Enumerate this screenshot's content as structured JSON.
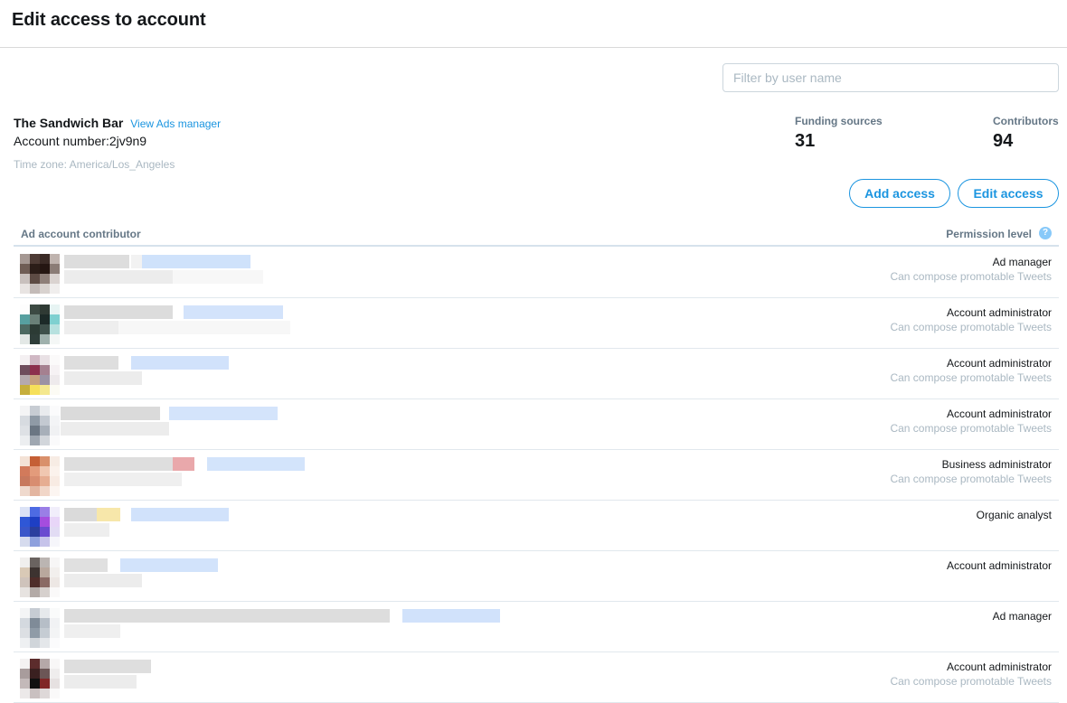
{
  "page": {
    "title": "Edit access to account"
  },
  "filter": {
    "placeholder": "Filter by user name",
    "value": ""
  },
  "account": {
    "name": "The Sandwich Bar",
    "view_ads_manager_label": "View Ads manager",
    "number_text": "Account number:2jv9n9",
    "timezone_text": "Time zone: America/Los_Angeles"
  },
  "stats": {
    "funding_sources_label": "Funding sources",
    "funding_sources_value": "31",
    "contributors_label": "Contributors",
    "contributors_value": "94"
  },
  "actions": {
    "add_access_label": "Add access",
    "edit_access_label": "Edit access"
  },
  "table": {
    "col_contributor": "Ad account contributor",
    "col_permission": "Permission level",
    "help_glyph": "?",
    "rows": [
      {
        "permission": "Ad manager",
        "sub": "Can compose promotable Tweets",
        "avatar": [
          "#a59893",
          "#4d3b35",
          "#3b2b26",
          "#bfb3ae",
          "#6f5d55",
          "#2b1d18",
          "#251612",
          "#8b7c76",
          "#c8c0bd",
          "#5d4b44",
          "#8e7f79",
          "#dad3d0",
          "#e8e4e2",
          "#c3bbb8",
          "#d8d2cf",
          "#f0eeed"
        ]
      },
      {
        "permission": "Account administrator",
        "sub": "Can compose promotable Tweets",
        "avatar": [
          "#fdfdfd",
          "#3c4a43",
          "#2f3a34",
          "#e7f4f3",
          "#57a0a0",
          "#6a8078",
          "#1c2a28",
          "#7ed0d0",
          "#4d6a62",
          "#2c3b35",
          "#3e504b",
          "#b7e1df",
          "#e3e8e6",
          "#2f3e3a",
          "#9fb1ad",
          "#f4f7f6"
        ]
      },
      {
        "permission": "Account administrator",
        "sub": "Can compose promotable Tweets",
        "avatar": [
          "#f4f0f2",
          "#d0b8c4",
          "#e9e1e5",
          "#fbfafa",
          "#6e4c5c",
          "#8c2f4d",
          "#a58090",
          "#f6f2f4",
          "#b5a9ae",
          "#c5a07f",
          "#9b92a4",
          "#eeeaec",
          "#c6ae3c",
          "#f6e05a",
          "#f4e88e",
          "#fcfbf4"
        ]
      },
      {
        "permission": "Account administrator",
        "sub": "Can compose promotable Tweets",
        "avatar": [
          "#f4f4f5",
          "#c7ccd3",
          "#e9ebee",
          "#fbfbfc",
          "#d7dbe0",
          "#8f9aa6",
          "#c3c9d1",
          "#f3f4f6",
          "#dee1e5",
          "#6b7683",
          "#a7afb9",
          "#f0f1f3",
          "#eceef0",
          "#9fa7b1",
          "#d2d6db",
          "#fafafb"
        ]
      },
      {
        "permission": "Business administrator",
        "sub": "Can compose promotable Tweets",
        "avatar": [
          "#f3e2d6",
          "#c55f35",
          "#d9906b",
          "#f7ece4",
          "#d27a5b",
          "#e39b7b",
          "#f0c7b1",
          "#fbf2ec",
          "#c7785d",
          "#d88d70",
          "#e6ad92",
          "#f8ebe3",
          "#efd9cd",
          "#e3b5a0",
          "#f1d6c8",
          "#fcf5f1"
        ]
      },
      {
        "permission": "Organic analyst",
        "sub": "",
        "avatar": [
          "#dbe2f6",
          "#4d6be3",
          "#9a7ee6",
          "#f1eefb",
          "#2f57d6",
          "#1e3fc4",
          "#a54dde",
          "#e8d6f8",
          "#3a56c9",
          "#2a3e9e",
          "#6a4bd0",
          "#e2dcf4",
          "#d6dbee",
          "#8ea0dd",
          "#c6c3ea",
          "#f6f6fb"
        ]
      },
      {
        "permission": "Account administrator",
        "sub": "",
        "avatar": [
          "#f0efee",
          "#6a6360",
          "#bbb5b2",
          "#f7f6f6",
          "#d9c9b6",
          "#3d3330",
          "#b9a89d",
          "#f2efed",
          "#cfc3bb",
          "#4f2d29",
          "#8a6a64",
          "#ede7e4",
          "#e7e3e0",
          "#b3aaa6",
          "#d6d0cd",
          "#faf9f9"
        ]
      },
      {
        "permission": "Ad manager",
        "sub": "",
        "avatar": [
          "#f4f5f6",
          "#c6ccd3",
          "#e6e9ec",
          "#fafbfb",
          "#d4d9df",
          "#7f8b98",
          "#b6bec7",
          "#f1f2f4",
          "#dcdfe3",
          "#8f9ba7",
          "#c5ccd3",
          "#f3f4f5",
          "#eef0f2",
          "#d0d5da",
          "#e4e7ea",
          "#fbfbfc"
        ]
      },
      {
        "permission": "Account administrator",
        "sub": "Can compose promotable Tweets",
        "avatar": [
          "#f4f2f2",
          "#5c2c2c",
          "#b5a8a8",
          "#f8f7f7",
          "#a89c9c",
          "#3a2020",
          "#6c5656",
          "#efeded",
          "#c3b9b9",
          "#111111",
          "#802626",
          "#e6e1e1",
          "#ece9e9",
          "#c9c0c0",
          "#ded8d8",
          "#faf9f9"
        ]
      }
    ]
  }
}
